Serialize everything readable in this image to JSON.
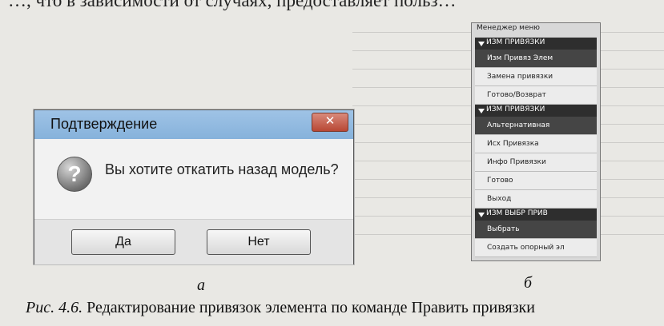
{
  "background_text": "…, что в зависимости от случаях, предоставляет польз…",
  "dialog": {
    "title": "Подтверждение",
    "close_glyph": "✕",
    "icon_glyph": "?",
    "message": "Вы хотите откатить назад модель?",
    "yes_label": "Да",
    "no_label": "Нет"
  },
  "menu": {
    "title": "Менеджер меню",
    "rows": [
      {
        "type": "head",
        "label": "ИЗМ ПРИВЯЗКИ"
      },
      {
        "type": "item",
        "label": "Изм Привяз Элем",
        "selected": true
      },
      {
        "type": "item",
        "label": "Замена привязки",
        "selected": false
      },
      {
        "type": "item",
        "label": "Готово/Возврат",
        "selected": false
      },
      {
        "type": "head",
        "label": "ИЗМ ПРИВЯЗКИ"
      },
      {
        "type": "item",
        "label": "Альтернативная",
        "selected": true
      },
      {
        "type": "item",
        "label": "Исх Привязка",
        "selected": false
      },
      {
        "type": "item",
        "label": "Инфо Привязки",
        "selected": false
      },
      {
        "type": "item",
        "label": "Готово",
        "selected": false
      },
      {
        "type": "item",
        "label": "Выход",
        "selected": false
      },
      {
        "type": "head",
        "label": "ИЗМ ВЫБР ПРИВ"
      },
      {
        "type": "item",
        "label": "Выбрать",
        "selected": true
      },
      {
        "type": "item",
        "label": "Создать опорный эл",
        "selected": false
      }
    ]
  },
  "labels": {
    "a": "а",
    "b": "б"
  },
  "caption": {
    "fig": "Рис. 4.6.",
    "text": " Редактирование привязок элемента по команде Править привязки"
  },
  "colors": {
    "titlebar": "#8fb7df",
    "close_button": "#c65a45",
    "menu_head": "#2e2e2e",
    "menu_selected": "#454545"
  }
}
